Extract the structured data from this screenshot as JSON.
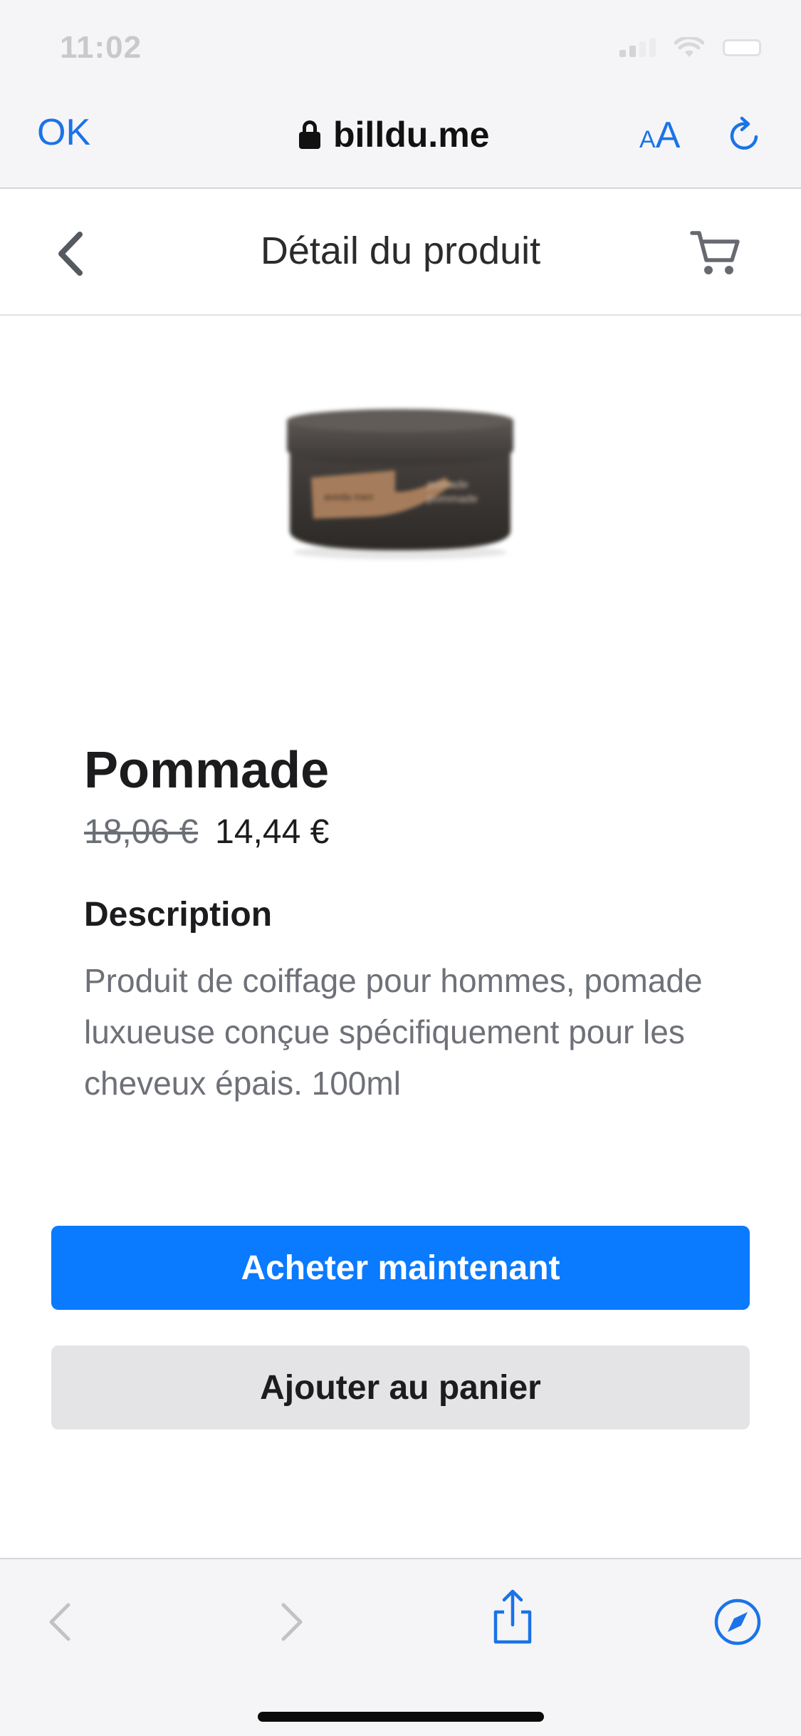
{
  "status_bar": {
    "time": "11:02"
  },
  "safari": {
    "done_label": "OK",
    "url": "billdu.me",
    "text_size_small": "A",
    "text_size_big": "A",
    "accent_color": "#1a73e8"
  },
  "header": {
    "title": "Détail du produit",
    "back_icon": "chevron-left-icon",
    "cart_icon": "cart-icon"
  },
  "product": {
    "name": "Pommade",
    "old_price": "18,06 €",
    "new_price": "14,44 €",
    "description_title": "Description",
    "description": "Produit de coiffage pour hommes, pomade luxueuse conçue spécifiquement pour les cheveux épais. 100ml",
    "image_label_line1": "pomade",
    "image_label_line2": "pommade"
  },
  "actions": {
    "buy_now": "Acheter maintenant",
    "add_to_cart": "Ajouter au panier",
    "primary_color": "#0a7aff"
  },
  "toolbar": {
    "icons": [
      "back-arrow-icon",
      "forward-arrow-icon",
      "share-icon",
      "compass-icon"
    ]
  }
}
